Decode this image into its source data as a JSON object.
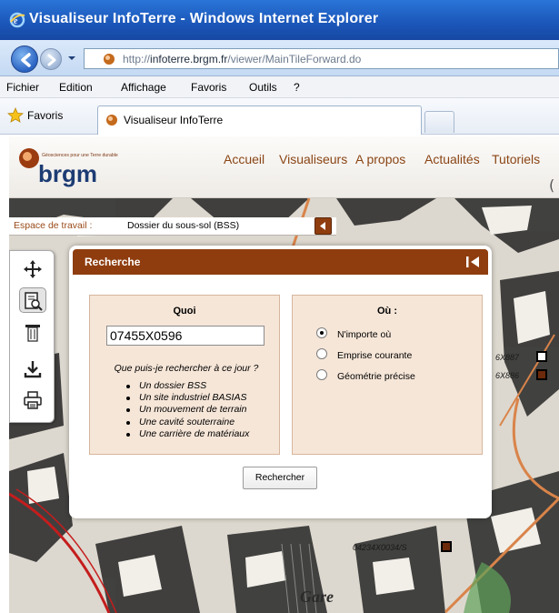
{
  "window": {
    "title": "Visualiseur InfoTerre - Windows Internet Explorer"
  },
  "address_bar": {
    "url_prefix": "http://",
    "url_host": "infoterre.brgm.fr",
    "url_path": "/viewer/MainTileForward.do"
  },
  "menu": {
    "items": [
      "Fichier",
      "Edition",
      "Affichage",
      "Favoris",
      "Outils",
      "?"
    ]
  },
  "favorites_bar": {
    "favorites_label": "Favoris",
    "tab_title": "Visualiseur InfoTerre"
  },
  "site": {
    "logo_tagline": "Géosciences pour une Terre durable",
    "logo_text": "brgm",
    "nav": [
      "Accueil",
      "Visualiseurs",
      "A propos",
      "Actualités",
      "Tutoriels"
    ],
    "header_cut_char": "("
  },
  "workspace": {
    "label": "Espace de travail :",
    "value": "Dossier du sous-sol (BSS)"
  },
  "toolbar": {
    "icons": [
      "move-arrows-icon",
      "search-document-icon",
      "borehole-icon",
      "download-icon",
      "print-icon"
    ],
    "active_index": 1
  },
  "dialog": {
    "title": "Recherche",
    "quoi": {
      "title": "Quoi",
      "input_value": "07455X0596",
      "hint": "Que puis-je rechercher à ce jour ?",
      "hint_items": [
        "Un dossier BSS",
        "Un site industriel BASIAS",
        "Un mouvement de terrain",
        "Une cavité souterraine",
        "Une carrière de matériaux"
      ]
    },
    "ou": {
      "title": "Où :",
      "options": [
        "N'importe où",
        "Emprise courante",
        "Géométrie précise"
      ],
      "selected_index": 0
    },
    "search_button": "Rechercher"
  },
  "map": {
    "labels": [
      "6X887",
      "6X886",
      "04234X0034/S"
    ],
    "place_label": "Gare",
    "colors": {
      "brand_brown": "#8f3d0f",
      "panel_beige": "#f6e6d8",
      "road_orange": "#d9844a",
      "rail_red": "#c41d1d"
    }
  }
}
